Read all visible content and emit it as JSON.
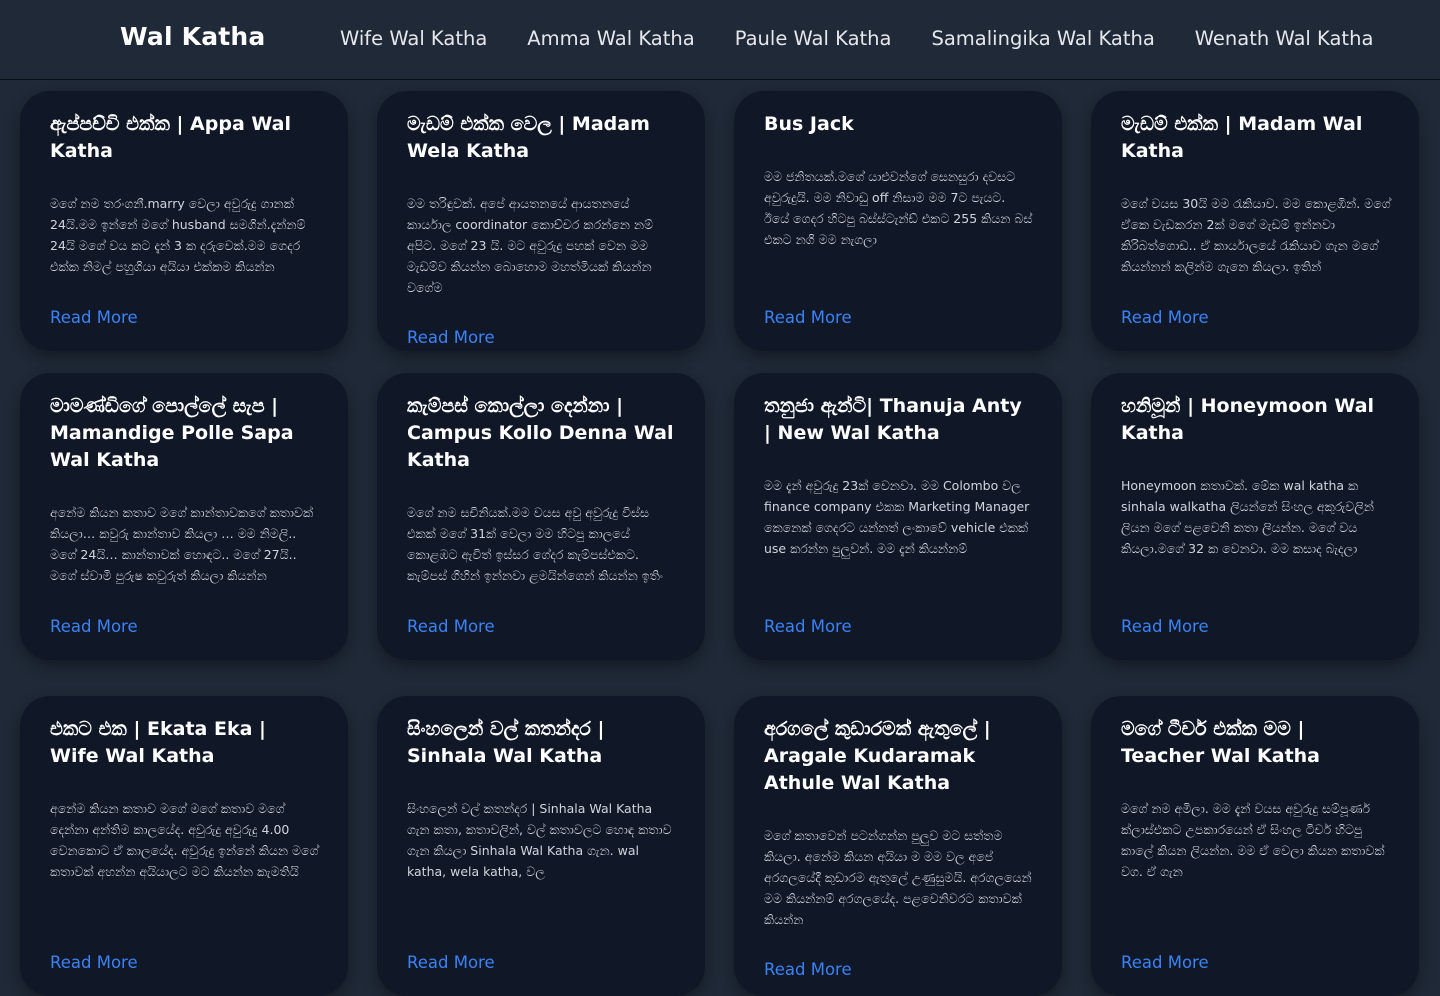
{
  "navbar": {
    "brand": "Wal Katha",
    "links": [
      {
        "label": "Wife Wal Katha"
      },
      {
        "label": "Amma Wal Katha"
      },
      {
        "label": "Paule Wal Katha"
      },
      {
        "label": "Samalingika Wal Katha"
      },
      {
        "label": "Wenath Wal Katha"
      }
    ]
  },
  "cards": [
    {
      "title": "ඇප්පච්චි එක්ක | Appa Wal Katha",
      "excerpt": "මගේ නම තරංගනී.marry වෙලා අවුරුදු ගානක් 24යි.මම ඉන්නේ මගේ husband සමගින්.දැන්නම් 24යි මගේ වය කට දැන් 3 ක දරුවෙක්.මම ගෙදර එක්ක නිමල් පහුගියා අයියා එක්කම කියන්න",
      "read_more": "Read More"
    },
    {
      "title": "මැඩම් එක්ක වෙල | Madam Wela Katha",
      "excerpt": "මම තරිඳුවක්. අපේ ආයතනයේ ආයතනයේ කාර්යාල coordinator කොච්චර කරන්නෙ නම් අපිට. මගේ 23 යි. මට අවුරුදු පහක් වෙන මම මැඩම්ව කියන්න බොහොම මහත්මියක් කියන්න වගේම",
      "read_more": "Read More"
    },
    {
      "title": "Bus Jack",
      "excerpt": "මම ජනිතයක්.මගේ යාළුවන්ගේ සෙනසුරා දවසට අවුරුදුයි. මම නිවාඩු off නිසාම මම 7ට පැයට. ඊයේ ගෙදර හිටපු බස්ස්ටැන්ඩ් එකට 255 කියන බස් එකට නගි මම නැගලා",
      "read_more": "Read More"
    },
    {
      "title": "මැඩම් එක්ක | Madam Wal Katha",
      "excerpt": "මගේ වයස 30යි මම රැකියාව. මම කොළඹින්. මගේ ඒකෙ වැඩකරන 2ක් මගේ මැඩම් ඉන්නවා කිරිබත්ගොඩ.. ඒ කාර්යාලයේ රැකියාව ගැන මගේ කියන්නන් කලින්ම ගැනෙ කියලා. ඉතින්",
      "read_more": "Read More"
    },
    {
      "title": "මාමණ්ඩිගේ පොල්ලේ සැප | Mamandige Polle Sapa Wal Katha",
      "excerpt": "අනේම කියන කතාව මගේ කාන්තාවකගේ කතාවක් කියලා… කවුරු කාන්තාව කියලා … මම නිමලි.. මගේ 24යි… කාන්තාවක් හොඳට.. මගේ 27යි.. මගේ ස්වාමි පුරුෂ කවුරුත් කියලා කියන්න",
      "read_more": "Read More"
    },
    {
      "title": "කැම්පස් කොල්ලා දෙන්නා | Campus Kollo Denna Wal Katha",
      "excerpt": "මගේ නම සචිනියක්.මම වයස අවු අවුරුදු විස්ස එකක් මගේ 31ක් වෙලා මම හිටපු කාලයේ කොළඹට ඇවිත් ඉස්සර ගේදර කැම්පස්එකට. කැම්පස් ගිහින් ඉන්නවා ළමයින්ගෙන් කියන්න ඉතිං",
      "read_more": "Read More"
    },
    {
      "title": "තනුජා ඇන්ටි| Thanuja Anty | New Wal Katha",
      "excerpt": "මම දැන් අවුරුදු 23ක් වෙනවා. මම Colombo වල finance company එකක Marketing Manager කෙනෙක් ගෙදරට යන්නත් ලංකාවේ vehicle එකක් use කරන්න පුලුවන්. මම දැන් කියන්නම්",
      "read_more": "Read More"
    },
    {
      "title": "හනිමූන් | Honeymoon Wal Katha",
      "excerpt": "Honeymoon  කතාවක්. මේක wal katha ක sinhala walkatha ලියන්නේ සිංහල අකුරුවලින් ලියන මගේ පළවෙනි කතා ලියන්න. මගේ වය කියලා.මගේ 32 ක වෙනවා. මම කසාද බැදලා",
      "read_more": "Read More"
    },
    {
      "title": "එකට එක | Ekata Eka | Wife Wal Katha",
      "excerpt": "අනේම කියන කතාව මගේ මගේ කතාව මගේ දෙන්නා අන්තිම කාලයේද. අවුරුදු අවුරුදු 4.00 වෙනකොට ඒ කාලයේද. අවුරුදු ඉන්නේ කියන මගේ කතාවක් අහන්න අයියාලට මට කියන්න කැමතියි",
      "read_more": "Read More"
    },
    {
      "title": "සිංහලෙන් වල් කතන්දර | Sinhala Wal Katha",
      "excerpt": "සිංහලෙන් වල් කතන්දර | Sinhala Wal Katha ගැන කතා, කතාවලින්, වල් කතාවලට හොඳ කතාව ගැන කියලා Sinhala Wal Katha ගැන. wal katha, wela katha, වල",
      "read_more": "Read More"
    },
    {
      "title": "අරගලේ කුඩාරමක් ඇතුලේ | Aragale Kudaramak Athule Wal Katha",
      "excerpt": "මගේ කතාවෙන් පටන්ගන්න පුලුව මට සත්තම කියලා. අනේම කියන අයියා ම මම වල අපේ අරගලයේදී කුඩාරම ඇතුලේ උණුසුමයි. අරගලයෙන් මම කියන්නම් අරගලයේද. පළවෙනිවරට කතාවක් කියන්න",
      "read_more": "Read More"
    },
    {
      "title": "මගේ ටීචර් එක්ක මම | Teacher Wal Katha",
      "excerpt": "මගේ නම අමිලා. මම දැන් වයස අවුරුදු  සම්පූර්ණ ක්ලාස්එකට උපකාරයෙන් ඒ සිංහල ටීචර් හිටපු කාලේ කියන ලියන්න. මම ඒ වෙලා කියන කතාවක් වග. ඒ ගැන",
      "read_more": "Read More"
    }
  ]
}
